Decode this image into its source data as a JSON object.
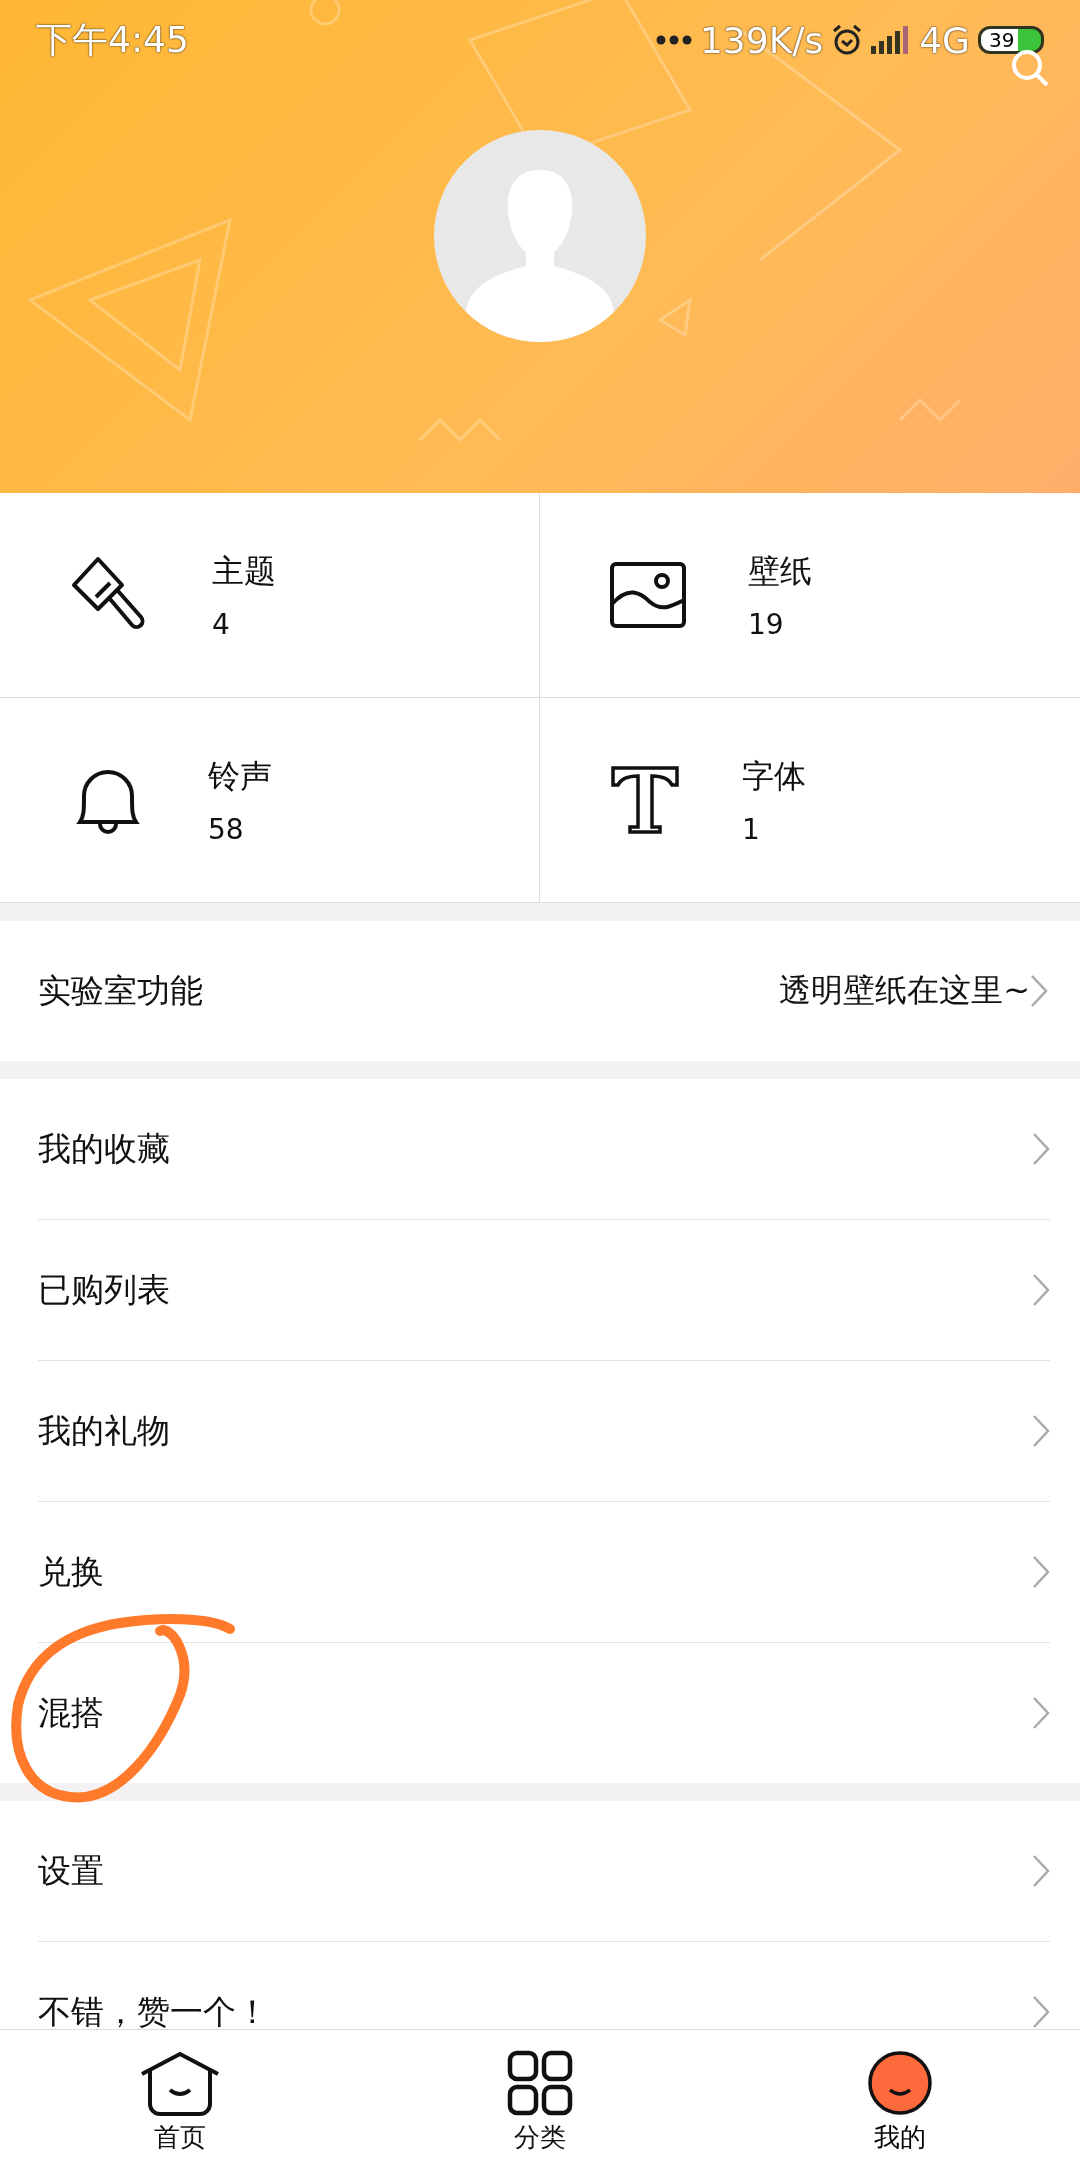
{
  "status_bar": {
    "time": "下午4:45",
    "speed": "139K/s",
    "network": "4G",
    "battery": "39"
  },
  "stats": [
    {
      "kind": "theme",
      "label": "主题",
      "count": "4"
    },
    {
      "kind": "wallpaper",
      "label": "壁纸",
      "count": "19"
    },
    {
      "kind": "ringtone",
      "label": "铃声",
      "count": "58"
    },
    {
      "kind": "font",
      "label": "字体",
      "count": "1"
    }
  ],
  "lab": {
    "label": "实验室功能",
    "hint": "透明壁纸在这里~"
  },
  "groups": [
    [
      {
        "label": "我的收藏",
        "circled": false
      },
      {
        "label": "已购列表",
        "circled": false
      },
      {
        "label": "我的礼物",
        "circled": false
      },
      {
        "label": "兑换",
        "circled": false
      },
      {
        "label": "混搭",
        "circled": true
      }
    ],
    [
      {
        "label": "设置",
        "circled": false
      },
      {
        "label": "不错，赞一个！",
        "circled": false
      }
    ]
  ],
  "nav": [
    {
      "kind": "home",
      "label": "首页",
      "selected": false
    },
    {
      "kind": "category",
      "label": "分类",
      "selected": false
    },
    {
      "kind": "me",
      "label": "我的",
      "selected": true
    }
  ]
}
